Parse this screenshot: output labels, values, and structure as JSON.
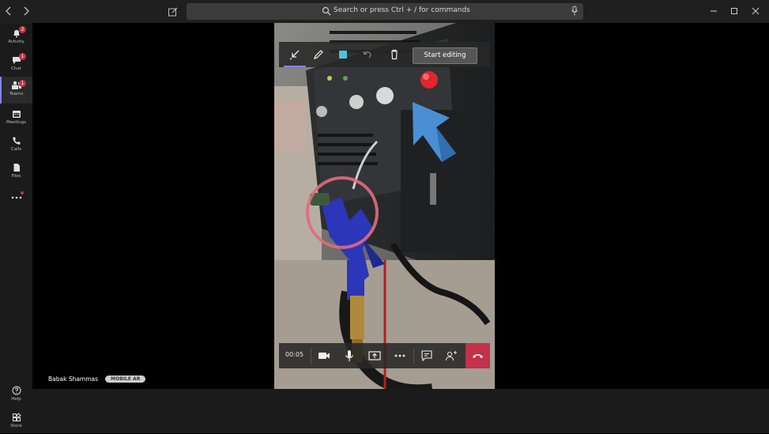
{
  "titlebar": {
    "search_text": "Search or press Ctrl + / for commands",
    "icons": [
      "back-icon",
      "forward-icon",
      "compose-icon",
      "search-icon",
      "microphone-icon",
      "minimize-icon",
      "maximize-icon",
      "close-icon"
    ]
  },
  "rail": {
    "items": [
      {
        "label": "Activity",
        "badge": "2"
      },
      {
        "label": "Chat",
        "badge": "1"
      },
      {
        "label": "Teams",
        "badge": "1"
      },
      {
        "label": "Meetings",
        "badge": ""
      },
      {
        "label": "Calls",
        "badge": ""
      },
      {
        "label": "Files",
        "badge": ""
      }
    ],
    "help_label": "Help",
    "store_label": "Store",
    "accent": "#7f85f5"
  },
  "annotation_toolbar": {
    "start_editing_label": "Start editing",
    "icons": [
      "collapse-icon",
      "pen-icon",
      "color-swatch-icon",
      "undo-icon",
      "delete-icon"
    ],
    "swatch_color": "#4fc3d9"
  },
  "call_bar": {
    "timer": "00:05",
    "icons": [
      "camera-icon",
      "microphone-icon",
      "share-screen-icon",
      "more-icon",
      "chat-icon",
      "add-people-icon",
      "hang-up-icon"
    ],
    "hangup_color": "#c4314b"
  },
  "participant": {
    "name": "Babak Shammas",
    "tag": "MOBILE AR"
  }
}
